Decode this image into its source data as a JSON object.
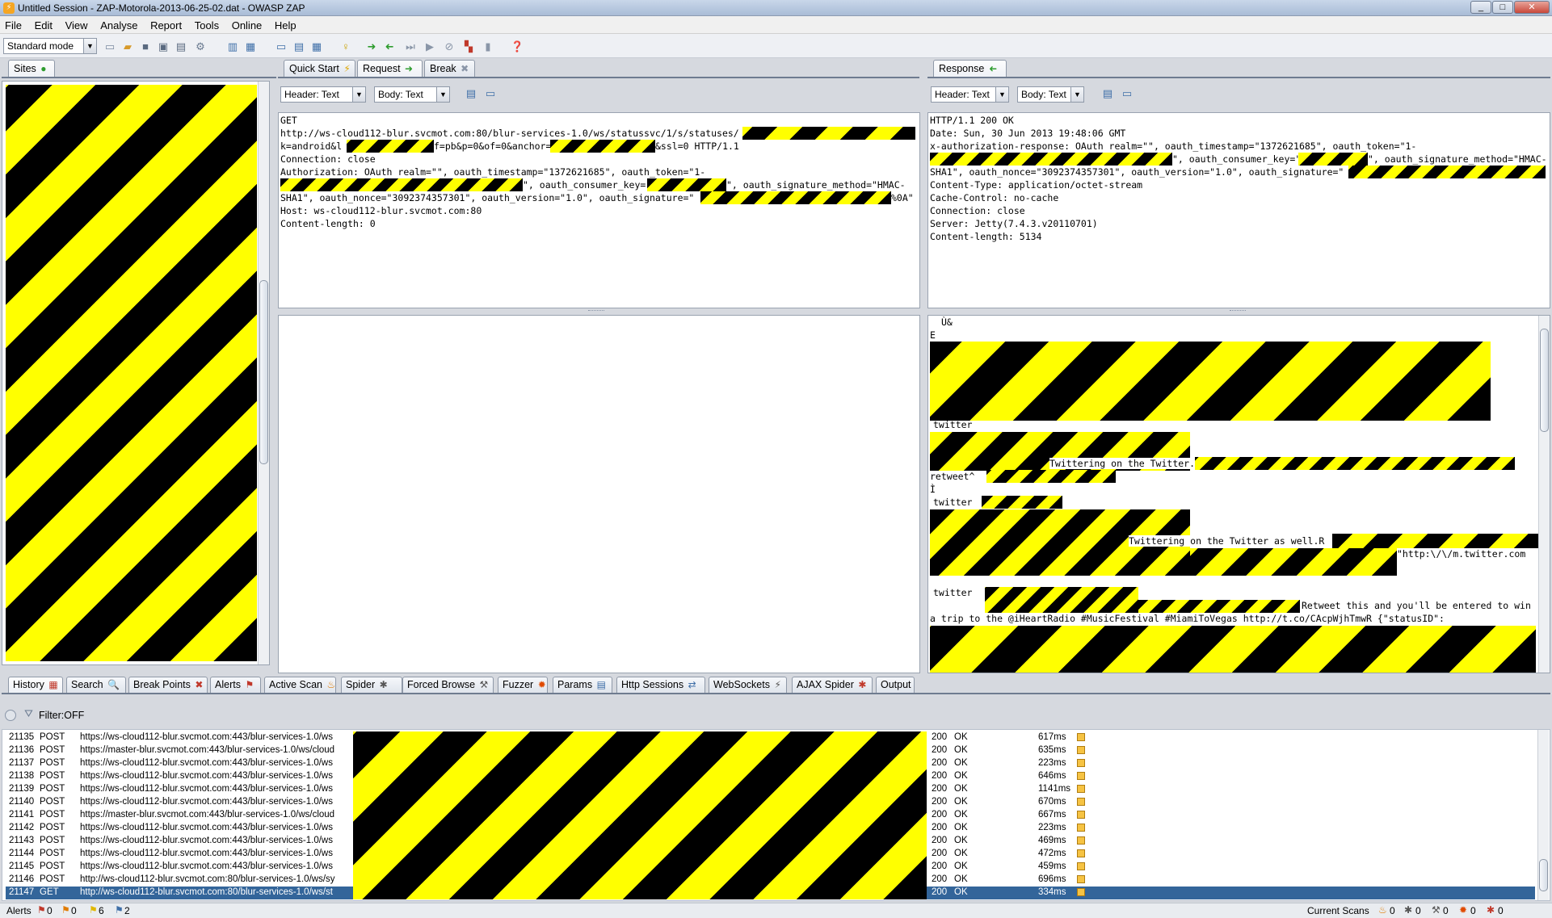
{
  "window": {
    "title": "Untitled Session - ZAP-Motorola-2013-06-25-02.dat - OWASP ZAP",
    "app_icon": "zap-lightning-icon",
    "controls": {
      "minimize": "_",
      "maximize": "□",
      "close": "✕"
    }
  },
  "menu": [
    "File",
    "Edit",
    "View",
    "Analyse",
    "Report",
    "Tools",
    "Online",
    "Help"
  ],
  "toolbar": {
    "mode_value": "Standard mode",
    "icons": [
      "new-session-icon",
      "open-session-icon",
      "save-session-icon",
      "snapshot-icon",
      "export-icon",
      "options-icon",
      "layout-icon",
      "panel-icon",
      "tab-layout-icon",
      "tab-layout-2-icon",
      "tab-layout-3-icon",
      "lightbulb-icon",
      "break-forward-icon",
      "break-back-icon",
      "step-icon",
      "continue-icon",
      "drop-icon",
      "scan-policy-icon",
      "marker-icon",
      "help-icon"
    ]
  },
  "sites_tab": {
    "label": "Sites"
  },
  "request_tabs": [
    {
      "label": "Quick Start",
      "icon": "lightning-icon"
    },
    {
      "label": "Request",
      "icon": "arrow-right-icon"
    },
    {
      "label": "Break",
      "icon": "cross-icon"
    }
  ],
  "response_tab": {
    "label": "Response",
    "icon": "arrow-left-icon"
  },
  "request_view": {
    "header_combo": "Header: Text",
    "body_combo": "Body: Text"
  },
  "response_view": {
    "header_combo": "Header: Text",
    "body_combo": "Body: Text"
  },
  "request_header": {
    "l1": "GET",
    "l2": "http://ws-cloud112-blur.svcmot.com:80/blur-services-1.0/ws/statussvc/1/s/statuses/",
    "l3a": "k=android&l",
    "l3b": "f=pb&p=0&of=0&anchor=",
    "l3c": "&ssl=0 HTTP/1.1",
    "l4": "Connection: close",
    "l5": "Authorization: OAuth realm=\"\", oauth_timestamp=\"1372621685\", oauth_token=\"1-",
    "l6a": "\", oauth_consumer_key=\"",
    "l6b": "\", oauth_signature_method=\"HMAC-",
    "l7a": "SHA1\", oauth_nonce=\"3092374357301\", oauth_version=\"1.0\", oauth_signature=\"",
    "l7b": "%0A\"",
    "l8": "Host: ws-cloud112-blur.svcmot.com:80",
    "l9": "Content-length: 0"
  },
  "response_header": {
    "l1": "HTTP/1.1 200 OK",
    "l2": "Date: Sun, 30 Jun 2013 19:48:06 GMT",
    "l3": "x-authorization-response: OAuth realm=\"\", oauth_timestamp=\"1372621685\", oauth_token=\"1-",
    "l4a": "\", oauth_consumer_key=\"",
    "l4b": "\", oauth_signature_method=\"HMAC-",
    "l5": "SHA1\", oauth_nonce=\"3092374357301\", oauth_version=\"1.0\", oauth_signature=\"",
    "l6": "Content-Type: application/octet-stream",
    "l7": "Cache-Control: no-cache",
    "l8": "Connection: close",
    "l9": "Server: Jetty(7.4.3.v20110701)",
    "l10": "Content-length: 5134"
  },
  "response_body": {
    "t0": "Ù&",
    "t1": "E",
    "t2": "twitter",
    "t3": "Twittering on the Twitter.",
    "t4": "retweet^",
    "t5": "Ì",
    "t6": "twitter",
    "t7": "Twittering on the Twitter as well.R",
    "t8": "\"http:\\/\\/m.twitter.com",
    "t9": "twitter",
    "t10": "Retweet this and you'll be entered to win",
    "t11": "a trip to the @iHeartRadio #MusicFestival #MiamiToVegas http://t.co/CAcpWjhTmwR {\"statusID\":"
  },
  "bottom_tabs": [
    {
      "label": "History",
      "icon": "history-icon"
    },
    {
      "label": "Search",
      "icon": "search-icon"
    },
    {
      "label": "Break Points",
      "icon": "breakpoint-icon"
    },
    {
      "label": "Alerts",
      "icon": "alerts-flag-icon"
    },
    {
      "label": "Active Scan",
      "icon": "active-scan-icon"
    },
    {
      "label": "Spider",
      "icon": "spider-icon"
    },
    {
      "label": "Forced Browse",
      "icon": "forced-browse-icon"
    },
    {
      "label": "Fuzzer",
      "icon": "fuzzer-icon"
    },
    {
      "label": "Params",
      "icon": "params-icon"
    },
    {
      "label": "Http Sessions",
      "icon": "http-sessions-icon"
    },
    {
      "label": "WebSockets",
      "icon": "websockets-icon"
    },
    {
      "label": "AJAX Spider",
      "icon": "ajax-spider-icon"
    },
    {
      "label": "Output",
      "icon": ""
    }
  ],
  "history": {
    "filter": "Filter:OFF",
    "rows": [
      {
        "id": "21135",
        "method": "POST",
        "url": "https://ws-cloud112-blur.svcmot.com:443/blur-services-1.0/ws",
        "code": "200",
        "reason": "OK",
        "rtt": "617ms"
      },
      {
        "id": "21136",
        "method": "POST",
        "url": "https://master-blur.svcmot.com:443/blur-services-1.0/ws/cloud",
        "code": "200",
        "reason": "OK",
        "rtt": "635ms"
      },
      {
        "id": "21137",
        "method": "POST",
        "url": "https://ws-cloud112-blur.svcmot.com:443/blur-services-1.0/ws",
        "code": "200",
        "reason": "OK",
        "rtt": "223ms"
      },
      {
        "id": "21138",
        "method": "POST",
        "url": "https://ws-cloud112-blur.svcmot.com:443/blur-services-1.0/ws",
        "code": "200",
        "reason": "OK",
        "rtt": "646ms"
      },
      {
        "id": "21139",
        "method": "POST",
        "url": "https://ws-cloud112-blur.svcmot.com:443/blur-services-1.0/ws",
        "code": "200",
        "reason": "OK",
        "rtt": "1141ms"
      },
      {
        "id": "21140",
        "method": "POST",
        "url": "https://ws-cloud112-blur.svcmot.com:443/blur-services-1.0/ws",
        "code": "200",
        "reason": "OK",
        "rtt": "670ms"
      },
      {
        "id": "21141",
        "method": "POST",
        "url": "https://master-blur.svcmot.com:443/blur-services-1.0/ws/cloud",
        "code": "200",
        "reason": "OK",
        "rtt": "667ms"
      },
      {
        "id": "21142",
        "method": "POST",
        "url": "https://ws-cloud112-blur.svcmot.com:443/blur-services-1.0/ws",
        "code": "200",
        "reason": "OK",
        "rtt": "223ms"
      },
      {
        "id": "21143",
        "method": "POST",
        "url": "https://ws-cloud112-blur.svcmot.com:443/blur-services-1.0/ws",
        "code": "200",
        "reason": "OK",
        "rtt": "469ms"
      },
      {
        "id": "21144",
        "method": "POST",
        "url": "https://ws-cloud112-blur.svcmot.com:443/blur-services-1.0/ws",
        "code": "200",
        "reason": "OK",
        "rtt": "472ms"
      },
      {
        "id": "21145",
        "method": "POST",
        "url": "https://ws-cloud112-blur.svcmot.com:443/blur-services-1.0/ws",
        "code": "200",
        "reason": "OK",
        "rtt": "459ms"
      },
      {
        "id": "21146",
        "method": "POST",
        "url": "http://ws-cloud112-blur.svcmot.com:80/blur-services-1.0/ws/sy",
        "code": "200",
        "reason": "OK",
        "rtt": "696ms"
      },
      {
        "id": "21147",
        "method": "GET",
        "url": "http://ws-cloud112-blur.svcmot.com:80/blur-services-1.0/ws/st",
        "code": "200",
        "reason": "OK",
        "rtt": "334ms",
        "selected": true
      }
    ]
  },
  "status": {
    "alerts_label": "Alerts",
    "high": "0",
    "medium": "0",
    "low": "6",
    "info": "2",
    "current_scans": "Current Scans",
    "scan_counts": [
      "0",
      "0",
      "0",
      "0",
      "0"
    ]
  },
  "colors": {
    "selection": "#33659a",
    "redaction_black": "#000000",
    "redaction_yellow": "#ffff00"
  }
}
